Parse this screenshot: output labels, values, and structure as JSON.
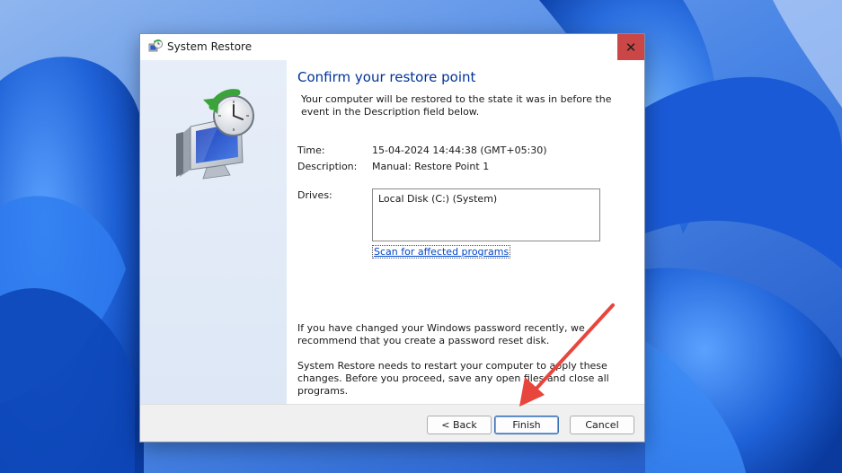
{
  "window": {
    "title": "System Restore",
    "close_glyph": "✕"
  },
  "content": {
    "heading": "Confirm your restore point",
    "intro": "Your computer will be restored to the state it was in before the event in the Description field below.",
    "time_label": "Time:",
    "time_value": "15-04-2024 14:44:38 (GMT+05:30)",
    "description_label": "Description:",
    "description_value": "Manual: Restore Point 1",
    "drives_label": "Drives:",
    "drives": [
      "Local Disk (C:) (System)"
    ],
    "scan_link": "Scan for affected programs",
    "password_note": "If you have changed your Windows password recently, we recommend that you create a password reset disk.",
    "restart_note": "System Restore needs to restart your computer to apply these changes. Before you proceed, save any open files and close all programs."
  },
  "buttons": {
    "back": "< Back",
    "finish": "Finish",
    "cancel": "Cancel"
  },
  "colors": {
    "heading": "#003399",
    "link": "#0046c8",
    "close_button": "#cb4747",
    "annotation_arrow": "#e8463c"
  },
  "icons": {
    "title": "system-restore-icon",
    "hero": "computer-restore-clock-icon",
    "close": "close-icon"
  }
}
